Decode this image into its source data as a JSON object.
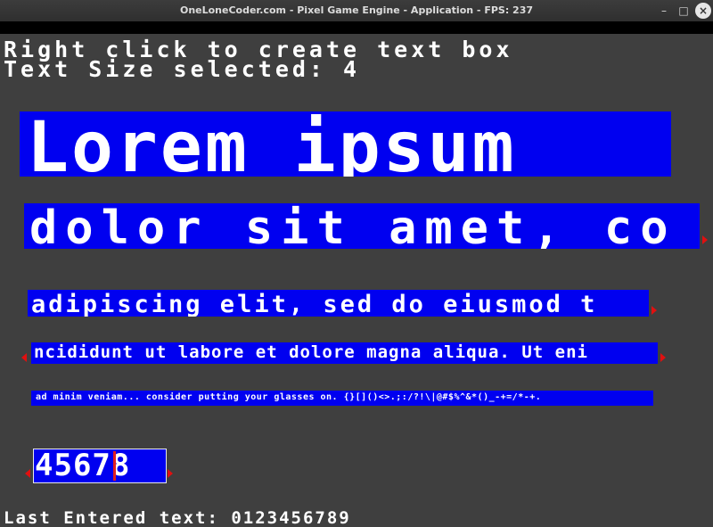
{
  "window": {
    "title": "OneLoneCoder.com - Pixel Game Engine - Application - FPS: 237",
    "minimize_label": "–",
    "maximize_label": "□",
    "close_label": "×"
  },
  "header": {
    "line1": "Right click to create text box",
    "line2": "Text Size selected: 4"
  },
  "text_boxes": [
    {
      "text": "Lorem ipsum"
    },
    {
      "text": "dolor sit amet, co"
    },
    {
      "text": "adipiscing elit, sed do eiusmod t"
    },
    {
      "text": "ncididunt ut labore et dolore magna aliqua. Ut eni"
    },
    {
      "text": "ad minim veniam... consider putting your glasses on. {}[]()<>.;:/?!\\|@#$%^&*()_-+=/*-+."
    },
    {
      "text": "45678"
    }
  ],
  "footer": {
    "last_entered": "Last Entered text: 0123456789"
  },
  "colors": {
    "background": "#3f3f3f",
    "textbox": "#0000f0",
    "text": "#ffffff",
    "scroll_arrow": "#e01010",
    "caret": "#e02020"
  },
  "icons": [
    "scroll-right-arrow-icon",
    "scroll-left-arrow-icon"
  ]
}
